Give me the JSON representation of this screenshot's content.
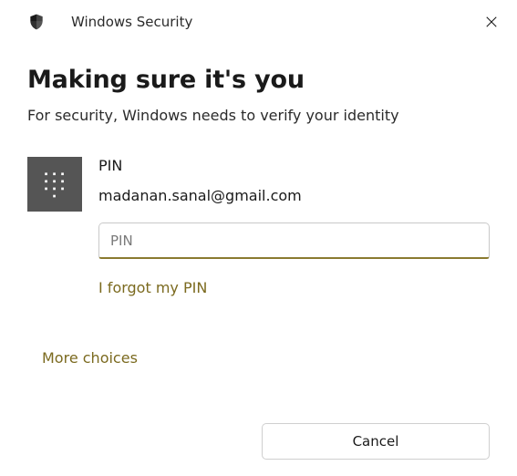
{
  "titlebar": {
    "app_name": "Windows Security"
  },
  "dialog": {
    "heading": "Making sure it's you",
    "subheading": "For security, Windows needs to verify your identity"
  },
  "credential": {
    "type_label": "PIN",
    "account_email": "madanan.sanal@gmail.com",
    "pin_placeholder": "PIN",
    "pin_value": "",
    "forgot_link": "I forgot my PIN"
  },
  "links": {
    "more_choices": "More choices"
  },
  "actions": {
    "cancel": "Cancel"
  },
  "colors": {
    "accent": "#8a7a2f",
    "link": "#7b6a1f",
    "tile_bg": "#555555"
  },
  "icons": {
    "shield": "shield-icon",
    "close": "close-icon",
    "keypad": "keypad-icon"
  }
}
